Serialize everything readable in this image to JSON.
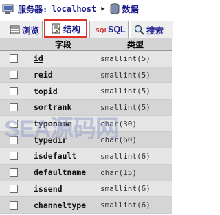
{
  "breadcrumb": {
    "server_label": "服务器:",
    "server_value": "localhost",
    "db_label": "数据"
  },
  "tabs": [
    {
      "label": "浏览",
      "icon": "browse-icon"
    },
    {
      "label": "结构",
      "icon": "structure-icon",
      "active": true
    },
    {
      "label": "SQL",
      "icon": "sql-icon"
    },
    {
      "label": "搜索",
      "icon": "search-icon"
    }
  ],
  "table": {
    "headers": {
      "field": "字段",
      "type": "类型"
    },
    "rows": [
      {
        "name": "id",
        "type": "smallint(5)",
        "primary": true
      },
      {
        "name": "reid",
        "type": "smallint(5)"
      },
      {
        "name": "topid",
        "type": "smallint(5)"
      },
      {
        "name": "sortrank",
        "type": "smallint(5)"
      },
      {
        "name": "typename",
        "type": "char(30)"
      },
      {
        "name": "typedir",
        "type": "char(60)"
      },
      {
        "name": "isdefault",
        "type": "smallint(6)"
      },
      {
        "name": "defaultname",
        "type": "char(15)"
      },
      {
        "name": "issend",
        "type": "smallint(6)"
      },
      {
        "name": "channeltype",
        "type": "smallint(6)"
      }
    ]
  },
  "watermark": "SEA源码网",
  "colors": {
    "active_tab_border": "#e0302a",
    "link_text": "#1a1a8c"
  }
}
